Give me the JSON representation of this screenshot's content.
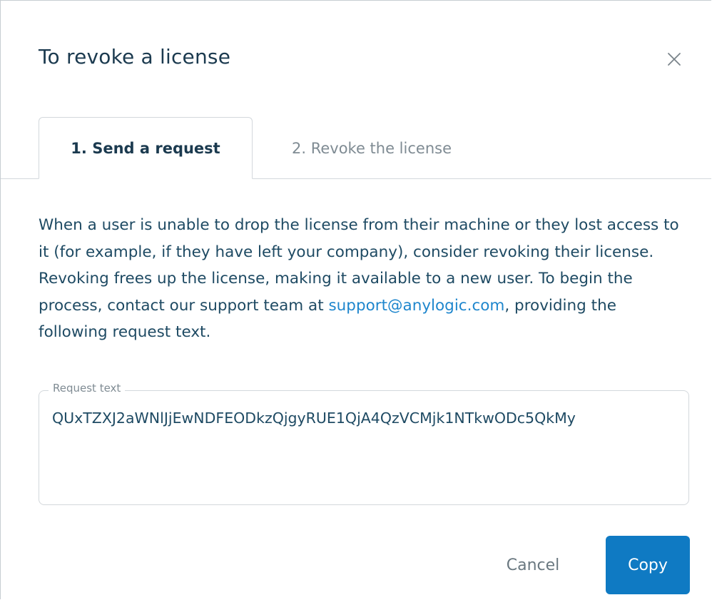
{
  "dialog": {
    "title": "To revoke a license",
    "close_icon": "close-icon"
  },
  "tabs": [
    {
      "label": "1. Send a request",
      "active": true
    },
    {
      "label": "2. Revoke the license",
      "active": false
    }
  ],
  "description": {
    "text_before_link": "When a user is unable to drop the license from their machine or they lost access to it (for example, if they have left your company), consider revoking their license. Revoking frees up the license, making it available to a new user. To begin the process, contact our support team at ",
    "link": "support@anylogic.com",
    "text_after_link": ", providing the following request text."
  },
  "request_field": {
    "label": "Request text",
    "value": "QUxTZXJ2aWNlJjEwNDFEODkzQjgyRUE1QjA4QzVCMjk1NTkwODc5QkMy"
  },
  "buttons": {
    "cancel": "Cancel",
    "copy": "Copy"
  },
  "colors": {
    "primary": "#0f7ac3",
    "link": "#1e86cd",
    "text": "#1e4a63"
  }
}
